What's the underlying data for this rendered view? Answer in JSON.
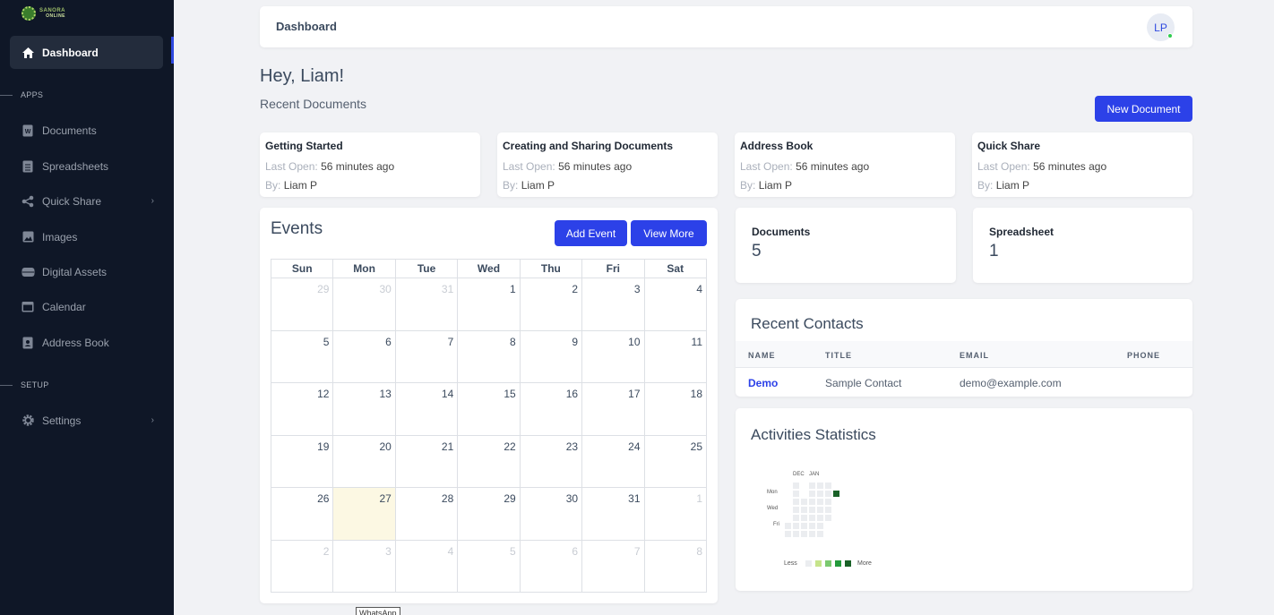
{
  "brand": {
    "line1": "SANORA",
    "line2": "ONLINE"
  },
  "sidebar": {
    "dashboard": "Dashboard",
    "apps_label": "APPS",
    "setup_label": "SETUP",
    "items": [
      {
        "label": "Documents",
        "icon": "word-doc-icon"
      },
      {
        "label": "Spreadsheets",
        "icon": "spreadsheet-icon"
      },
      {
        "label": "Quick Share",
        "icon": "share-icon"
      },
      {
        "label": "Images",
        "icon": "image-icon"
      },
      {
        "label": "Digital Assets",
        "icon": "drive-icon"
      },
      {
        "label": "Calendar",
        "icon": "calendar-icon"
      },
      {
        "label": "Address Book",
        "icon": "address-book-icon"
      }
    ],
    "settings": "Settings"
  },
  "header": {
    "title": "Dashboard",
    "avatar_initials": "LP"
  },
  "greeting": "Hey, Liam!",
  "recent_documents": {
    "label": "Recent Documents",
    "new_button": "New Document",
    "last_open_label": "Last Open:",
    "by_label": "By:",
    "items": [
      {
        "title": "Getting Started",
        "last_open": "56 minutes ago",
        "by": "Liam P"
      },
      {
        "title": "Creating and Sharing Documents",
        "last_open": "56 minutes ago",
        "by": "Liam P"
      },
      {
        "title": "Address Book",
        "last_open": "56 minutes ago",
        "by": "Liam P"
      },
      {
        "title": "Quick Share",
        "last_open": "56 minutes ago",
        "by": "Liam P"
      }
    ]
  },
  "events": {
    "title": "Events",
    "add_button": "Add Event",
    "view_more_button": "View More",
    "weekdays": [
      "Sun",
      "Mon",
      "Tue",
      "Wed",
      "Thu",
      "Fri",
      "Sat"
    ],
    "weeks": [
      [
        "29",
        "30",
        "31",
        "1",
        "2",
        "3",
        "4"
      ],
      [
        "5",
        "6",
        "7",
        "8",
        "9",
        "10",
        "11"
      ],
      [
        "12",
        "13",
        "14",
        "15",
        "16",
        "17",
        "18"
      ],
      [
        "19",
        "20",
        "21",
        "22",
        "23",
        "24",
        "25"
      ],
      [
        "26",
        "27",
        "28",
        "29",
        "30",
        "31",
        "1"
      ],
      [
        "2",
        "3",
        "4",
        "5",
        "6",
        "7",
        "8"
      ]
    ],
    "today": "27"
  },
  "stats": {
    "documents": {
      "label": "Documents",
      "value": "5"
    },
    "spreadsheets": {
      "label": "Spreadsheet",
      "value": "1"
    }
  },
  "contacts": {
    "title": "Recent Contacts",
    "columns": [
      "NAME",
      "TITLE",
      "EMAIL",
      "PHONE"
    ],
    "rows": [
      {
        "name": "Demo",
        "title": "Sample Contact",
        "email": "demo@example.com",
        "phone": ""
      }
    ]
  },
  "activities": {
    "title": "Activities Statistics",
    "months": [
      "DEC",
      "JAN"
    ],
    "days": [
      "Mon",
      "Wed",
      "Fri"
    ],
    "legend_less": "Less",
    "legend_more": "More",
    "legend_colors": [
      "#ebedf0",
      "#c6e48b",
      "#7bc96f",
      "#239a3b",
      "#196127"
    ],
    "active_color": "#196127"
  },
  "tooltip": "WhatsApp"
}
